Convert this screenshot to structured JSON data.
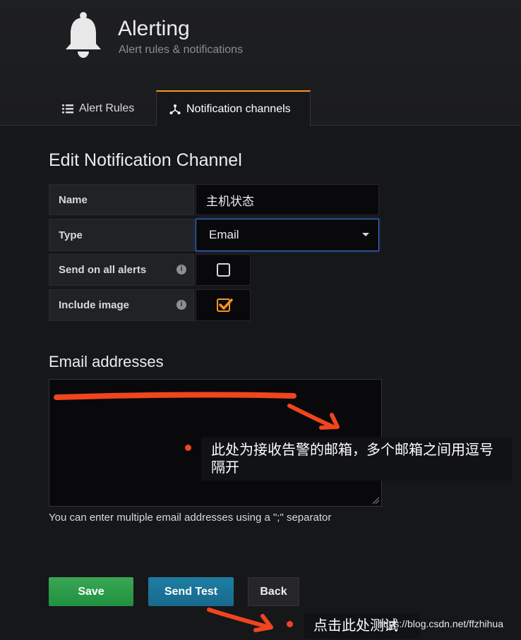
{
  "header": {
    "title": "Alerting",
    "subtitle": "Alert rules & notifications",
    "icon": "bell-icon"
  },
  "tabs": [
    {
      "label": "Alert Rules",
      "icon": "list-icon",
      "active": false
    },
    {
      "label": "Notification channels",
      "icon": "channels-icon",
      "active": true
    }
  ],
  "form": {
    "section_title": "Edit Notification Channel",
    "name_label": "Name",
    "name_value": "主机状态",
    "type_label": "Type",
    "type_value": "Email",
    "send_all_label": "Send on all alerts",
    "send_all_checked": false,
    "include_image_label": "Include image",
    "include_image_checked": true
  },
  "email": {
    "title": "Email addresses",
    "helper": "You can enter multiple email addresses using a \";\" separator"
  },
  "buttons": {
    "save": "Save",
    "send_test": "Send Test",
    "back": "Back"
  },
  "annotations": {
    "email_note": "此处为接收告警的邮箱，多个邮箱之间用逗号隔开",
    "test_note": "点击此处测试",
    "watermark": "https://blog.csdn.net/ffzhihua"
  },
  "colors": {
    "accent": "#f79520",
    "save": "#1f9140",
    "send_test": "#186a8c",
    "annotation_marker": "#f0451e"
  }
}
